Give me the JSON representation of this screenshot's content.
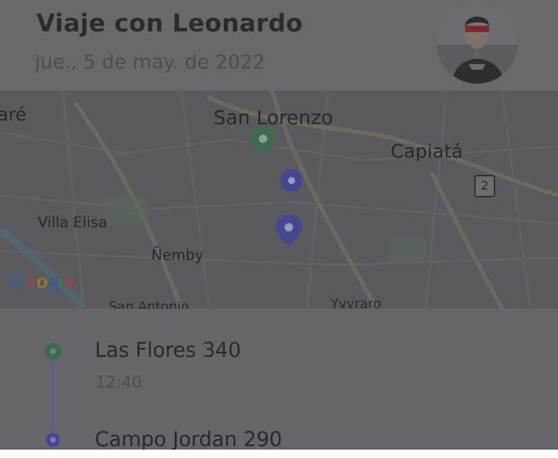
{
  "trip": {
    "title": "Viaje con Leonardo",
    "date": "jue., 5 de may. de 2022"
  },
  "map": {
    "labels": {
      "are": "aré",
      "san_lorenzo": "San Lorenzo",
      "capiata": "Capiatá",
      "route_shield": "2",
      "villa_elisa": "Villa Elisa",
      "nemby": "Ñemby",
      "san_antonio": "San Antonio",
      "ypane": "Yvyraro"
    },
    "google_logo": [
      "G",
      "o",
      "o",
      "g",
      "l",
      "e"
    ]
  },
  "route": {
    "stops": [
      {
        "name": "Las Flores 340",
        "time": "12:40",
        "color": "#3b6a4f"
      },
      {
        "name": "Campo Jordan 290",
        "color": "#474690"
      }
    ]
  },
  "colors": {
    "origin": "#3b6a4f",
    "destination": "#474690",
    "overlay_bg": "#68666c",
    "bottom_strip": "#fcfcfd"
  }
}
